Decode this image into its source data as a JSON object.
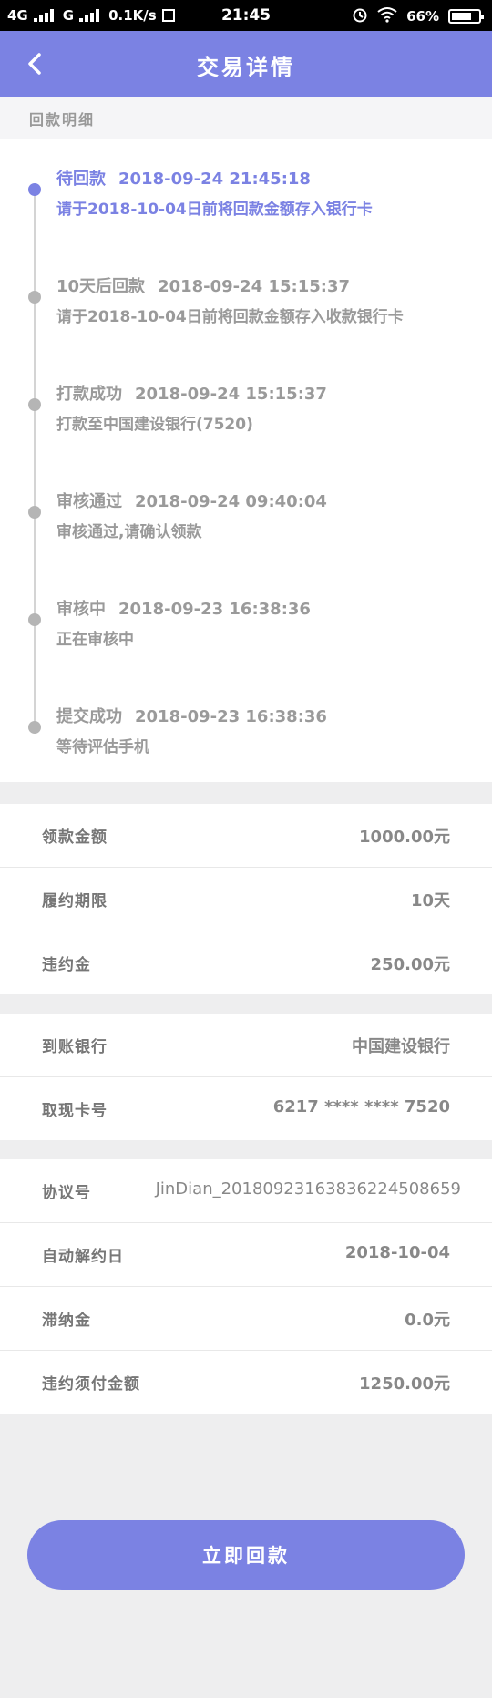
{
  "status_bar": {
    "network": "4G",
    "network2": "G",
    "speed": "0.1K/s",
    "time": "21:45",
    "battery": "66%"
  },
  "nav": {
    "title": "交易详情"
  },
  "section_title": "回款明细",
  "timeline": [
    {
      "status": "待回款",
      "time": "2018-09-24 21:45:18",
      "desc": "请于2018-10-04日前将回款金额存入银行卡",
      "active": true
    },
    {
      "status": "10天后回款",
      "time": "2018-09-24 15:15:37",
      "desc": "请于2018-10-04日前将回款金额存入收款银行卡",
      "active": false
    },
    {
      "status": "打款成功",
      "time": "2018-09-24 15:15:37",
      "desc": "打款至中国建设银行(7520)",
      "active": false
    },
    {
      "status": "审核通过",
      "time": "2018-09-24 09:40:04",
      "desc": "审核通过,请确认领款",
      "active": false
    },
    {
      "status": "审核中",
      "time": "2018-09-23 16:38:36",
      "desc": "正在审核中",
      "active": false
    },
    {
      "status": "提交成功",
      "time": "2018-09-23 16:38:36",
      "desc": "等待评估手机",
      "active": false
    }
  ],
  "amount_card": [
    {
      "label": "领款金额",
      "value": "1000.00元"
    },
    {
      "label": "履约期限",
      "value": "10天"
    },
    {
      "label": "违约金",
      "value": "250.00元"
    }
  ],
  "bank_card": [
    {
      "label": "到账银行",
      "value": "中国建设银行"
    },
    {
      "label": "取现卡号",
      "value": "6217 **** **** 7520"
    }
  ],
  "agreement_card": [
    {
      "label": "协议号",
      "value": "JinDian_20180923163836224508659"
    },
    {
      "label": "自动解约日",
      "value": "2018-10-04"
    },
    {
      "label": "滞纳金",
      "value": "0.0元"
    },
    {
      "label": "违约须付金额",
      "value": "1250.00元"
    }
  ],
  "cta_label": "立即回款",
  "colors": {
    "accent": "#7b82e3",
    "background": "#eeeeef"
  }
}
